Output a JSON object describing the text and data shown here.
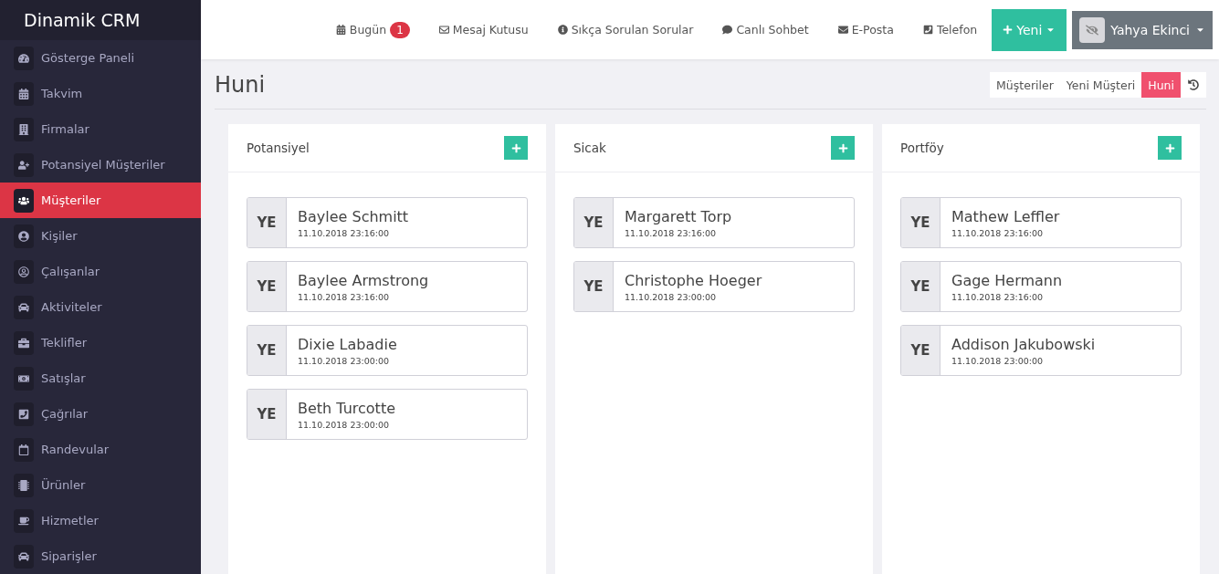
{
  "brand": "Dinamik CRM",
  "sidebar": {
    "items": [
      {
        "label": "Gösterge Paneli",
        "selected": false
      },
      {
        "label": "Takvim",
        "selected": false
      },
      {
        "label": "Firmalar",
        "selected": false
      },
      {
        "label": "Potansiyel Müşteriler",
        "selected": false
      },
      {
        "label": "Müşteriler",
        "selected": true
      },
      {
        "label": "Kişiler",
        "selected": false
      },
      {
        "label": "Çalışanlar",
        "selected": false
      },
      {
        "label": "Aktiviteler",
        "selected": false
      },
      {
        "label": "Teklifler",
        "selected": false
      },
      {
        "label": "Satışlar",
        "selected": false
      },
      {
        "label": "Çağrılar",
        "selected": false
      },
      {
        "label": "Randevular",
        "selected": false
      },
      {
        "label": "Ürünler",
        "selected": false
      },
      {
        "label": "Hizmetler",
        "selected": false
      },
      {
        "label": "Siparişler",
        "selected": false
      }
    ]
  },
  "topbar": {
    "links": [
      {
        "label": "Bugün",
        "badge": "1"
      },
      {
        "label": "Mesaj Kutusu"
      },
      {
        "label": "Sıkça Sorulan Sorular"
      },
      {
        "label": "Canlı Sohbet"
      },
      {
        "label": "E-Posta"
      },
      {
        "label": "Telefon"
      }
    ],
    "new_button": "Yeni",
    "user": "Yahya Ekinci"
  },
  "page": {
    "title": "Huni",
    "tabs": [
      {
        "label": "Müşteriler",
        "selected": false
      },
      {
        "label": "Yeni Müşteri",
        "selected": false
      },
      {
        "label": "Huni",
        "selected": true
      }
    ]
  },
  "columns": [
    {
      "title": "Potansiyel",
      "cards": [
        {
          "initials": "YE",
          "name": "Baylee Schmitt",
          "date": "11.10.2018 23:16:00"
        },
        {
          "initials": "YE",
          "name": "Baylee Armstrong",
          "date": "11.10.2018 23:16:00"
        },
        {
          "initials": "YE",
          "name": "Dixie Labadie",
          "date": "11.10.2018 23:00:00"
        },
        {
          "initials": "YE",
          "name": "Beth Turcotte",
          "date": "11.10.2018 23:00:00"
        }
      ]
    },
    {
      "title": "Sicak",
      "cards": [
        {
          "initials": "YE",
          "name": "Margarett Torp",
          "date": "11.10.2018 23:16:00"
        },
        {
          "initials": "YE",
          "name": "Christophe Hoeger",
          "date": "11.10.2018 23:00:00"
        }
      ]
    },
    {
      "title": "Portföy",
      "cards": [
        {
          "initials": "YE",
          "name": "Mathew Leffler",
          "date": "11.10.2018 23:16:00"
        },
        {
          "initials": "YE",
          "name": "Gage Hermann",
          "date": "11.10.2018 23:16:00"
        },
        {
          "initials": "YE",
          "name": "Addison Jakubowski",
          "date": "11.10.2018 23:00:00"
        }
      ]
    }
  ]
}
